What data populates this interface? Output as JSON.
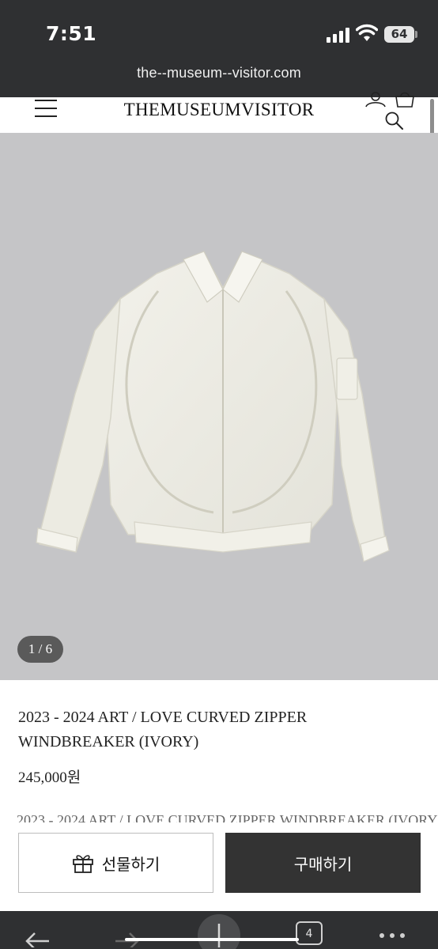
{
  "status_bar": {
    "time": "7:51",
    "battery": "64",
    "icons": [
      "signal-icon",
      "wifi-icon",
      "battery-icon"
    ]
  },
  "browser": {
    "url": "the--museum--visitor.com",
    "tab_count": "4",
    "toolbar_icons": [
      "back-arrow-icon",
      "forward-arrow-icon",
      "new-tab-plus-icon",
      "tabs-icon",
      "more-icon"
    ]
  },
  "header": {
    "brand": "THEMUSEUMVISITOR",
    "icons": [
      "menu-icon",
      "user-icon",
      "cart-icon",
      "search-icon"
    ]
  },
  "gallery": {
    "counter": "1 / 6",
    "background_color": "#c5c5c7",
    "product_color": "#efeee6"
  },
  "product": {
    "title": "2023 - 2024 ART / LOVE CURVED ZIPPER WINDBREAKER (IVORY)",
    "price": "245,000원",
    "description_preview": "2023 - 2024 ART / LOVE CURVED ZIPPER WINDBREAKER (IVORY)"
  },
  "actions": {
    "gift_label": "선물하기",
    "buy_label": "구매하기",
    "buy_color": "#333333"
  }
}
